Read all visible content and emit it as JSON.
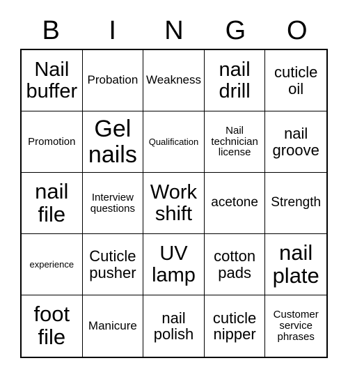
{
  "card": {
    "title": "BINGO",
    "header_letters": [
      "B",
      "I",
      "N",
      "G",
      "O"
    ],
    "colors": {
      "background": "#ffffff",
      "text": "#000000",
      "grid_line": "#000000"
    },
    "grid": {
      "rows": 5,
      "columns": 5,
      "cells": [
        {
          "text": "Nail buffer",
          "size": "lg"
        },
        {
          "text": "Probation",
          "size": "xs"
        },
        {
          "text": "Weakness",
          "size": "xs"
        },
        {
          "text": "nail drill",
          "size": "lg"
        },
        {
          "text": "cuticle oil",
          "size": "md"
        },
        {
          "text": "Promotion",
          "size": "xxs"
        },
        {
          "text": "Gel nails",
          "size": "xxl"
        },
        {
          "text": "Qualification",
          "size": "tiny"
        },
        {
          "text": "Nail technician license",
          "size": "xxs"
        },
        {
          "text": "nail groove",
          "size": "md"
        },
        {
          "text": "nail file",
          "size": "xl"
        },
        {
          "text": "Interview questions",
          "size": "xxs"
        },
        {
          "text": "Work shift",
          "size": "lg"
        },
        {
          "text": "acetone",
          "size": "sm"
        },
        {
          "text": "Strength",
          "size": "sm"
        },
        {
          "text": "experience",
          "size": "tiny"
        },
        {
          "text": "Cuticle pusher",
          "size": "md"
        },
        {
          "text": "UV lamp",
          "size": "lg"
        },
        {
          "text": "cotton pads",
          "size": "md"
        },
        {
          "text": "nail plate",
          "size": "xl"
        },
        {
          "text": "foot file",
          "size": "xl"
        },
        {
          "text": "Manicure",
          "size": "xs"
        },
        {
          "text": "nail polish",
          "size": "md"
        },
        {
          "text": "cuticle nipper",
          "size": "md"
        },
        {
          "text": "Customer service phrases",
          "size": "xxs"
        }
      ]
    }
  }
}
